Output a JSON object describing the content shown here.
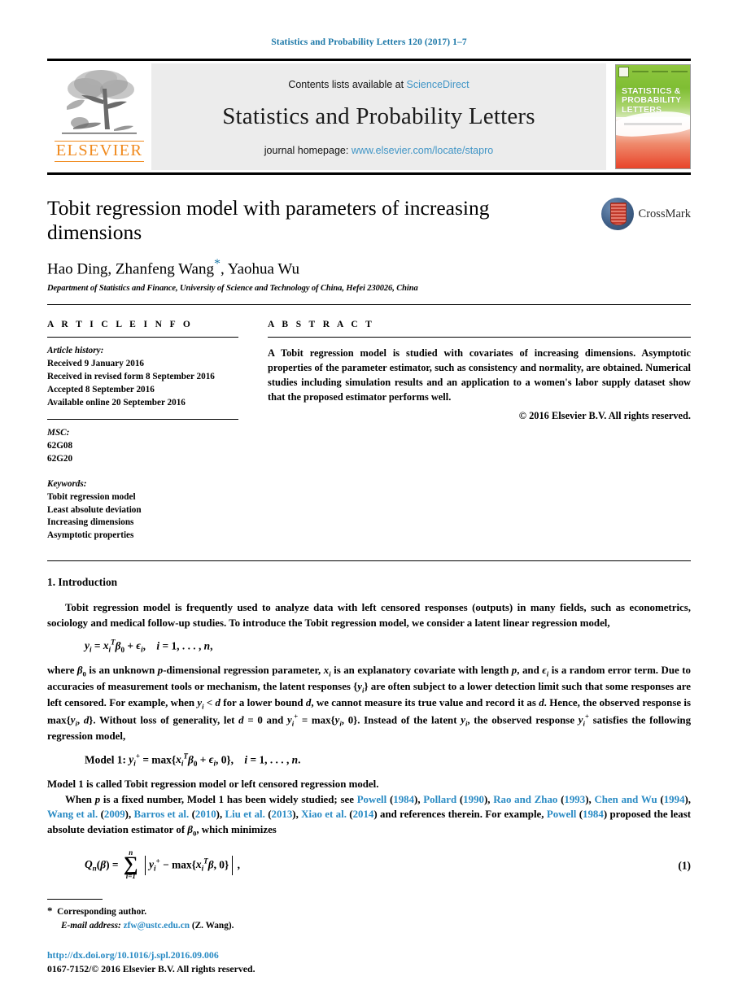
{
  "running_head": "Statistics and Probability Letters 120 (2017) 1–7",
  "masthead": {
    "contents_prefix": "Contents lists available at ",
    "contents_link": "ScienceDirect",
    "journal_title": "Statistics and Probability Letters",
    "homepage_prefix": "journal homepage: ",
    "homepage_link": "www.elsevier.com/locate/stapro",
    "publisher_wordmark": "ELSEVIER",
    "cover_title": "STATISTICS & PROBABILITY LETTERS",
    "accent_link_color": "#4095c6",
    "elsevier_orange": "#f08a1e"
  },
  "badge": {
    "label": "CrossMark",
    "name": "crossmark"
  },
  "title": "Tobit regression model with parameters of increasing dimensions",
  "authors": "Hao Ding, Zhanfeng Wang",
  "authors_tail": ", Yaohua Wu",
  "corresponding_marker": "*",
  "affiliation": "Department of Statistics and Finance, University of Science and Technology of China, Hefei 230026, China",
  "article_info": {
    "heading": "A R T I C L E   I N F O",
    "history_label": "Article history:",
    "history": [
      "Received 9 January 2016",
      "Received in revised form 8 September 2016",
      "Accepted 8 September 2016",
      "Available online 20 September 2016"
    ],
    "msc_label": "MSC:",
    "msc": [
      "62G08",
      "62G20"
    ],
    "keywords_label": "Keywords:",
    "keywords": [
      "Tobit regression model",
      "Least absolute deviation",
      "Increasing dimensions",
      "Asymptotic properties"
    ]
  },
  "abstract": {
    "heading": "A B S T R A C T",
    "text": "A Tobit regression model is studied with covariates of increasing dimensions. Asymptotic properties of the parameter estimator, such as consistency and normality, are obtained. Numerical studies including simulation results and an application to a women's labor supply dataset show that the proposed estimator performs well.",
    "copyright": "© 2016 Elsevier B.V. All rights reserved."
  },
  "body": {
    "section_number": "1.",
    "section_title": "Introduction",
    "p1": "Tobit regression model is frequently used to analyze data with left censored responses (outputs) in many fields, such as econometrics, sociology and medical follow-up studies. To introduce the Tobit regression model, we consider a latent linear regression model,",
    "p2_before_refs": "Model 1 is called Tobit regression model or left censored regression model.",
    "equation_1_number": "(1)"
  },
  "footnote": {
    "star": "*",
    "corresponding": "Corresponding author.",
    "email_label": "E-mail address:",
    "email": "zfw@ustc.edu.cn",
    "email_owner": "(Z. Wang)."
  },
  "publication_footer": {
    "doi": "http://dx.doi.org/10.1016/j.spl.2016.09.006",
    "issn_line": "0167-7152/© 2016 Elsevier B.V. All rights reserved."
  },
  "references_inline": [
    {
      "author": "Powell",
      "year": "1984"
    },
    {
      "author": "Pollard",
      "year": "1990"
    },
    {
      "author": "Rao and Zhao",
      "year": "1993"
    },
    {
      "author": "Chen and Wu",
      "year": "1994"
    },
    {
      "author": "Wang et al.",
      "year": "2009"
    },
    {
      "author": "Barros et al.",
      "year": "2010"
    },
    {
      "author": "Liu et al.",
      "year": "2013"
    },
    {
      "author": "Xiao et al.",
      "year": "2014"
    }
  ]
}
